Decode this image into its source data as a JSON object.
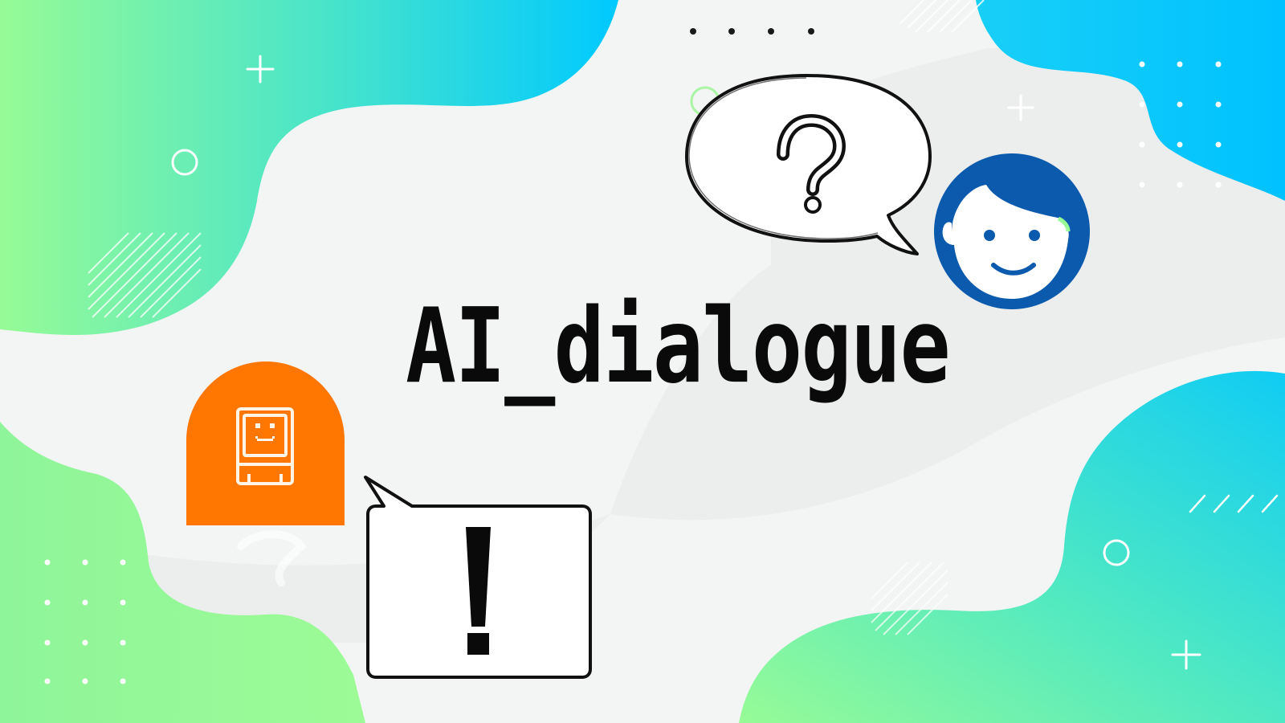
{
  "title": "AI_dialogue",
  "colors": {
    "background": "#f3f4f4",
    "green": "#97fb96",
    "cyan": "#00c9ff",
    "robot_orange": "#ff7600",
    "user_blue": "#0b5aad",
    "ink": "#0a0a0a"
  },
  "icons": {
    "robot": "robot-avatar-icon",
    "user": "user-avatar-icon",
    "question": "question-mark-icon",
    "exclamation": "exclamation-mark-icon"
  }
}
